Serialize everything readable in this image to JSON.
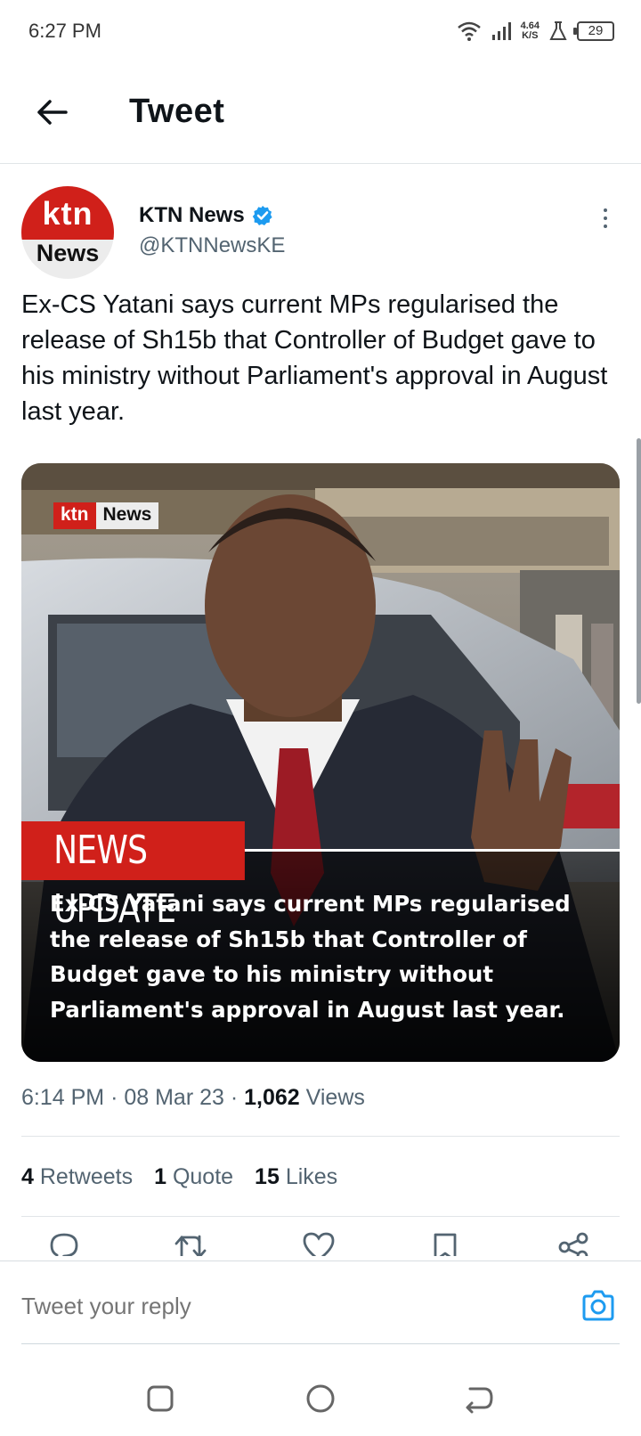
{
  "status_bar": {
    "time": "6:27 PM",
    "net_speed_value": "4.64",
    "net_speed_unit": "K/S",
    "battery": "29"
  },
  "header": {
    "title": "Tweet"
  },
  "tweet": {
    "author_name": "KTN News",
    "author_handle": "@KTNNewsKE",
    "avatar_top": "ktn",
    "avatar_bottom": "News",
    "text": "Ex-CS Yatani says current MPs regularised the release of Sh15b that Controller of Budget gave to his ministry without Parliament's approval in August last year.",
    "media": {
      "logo_ktn": "ktn",
      "logo_news": "News",
      "banner": "NEWS UPDATE",
      "caption_lines": [
        "Ex-CS Yatani says current MPs regularised",
        "the release of Sh15b that Controller of",
        "Budget gave to his ministry without",
        "Parliament's approval in August last year."
      ]
    },
    "time": "6:14 PM",
    "date": "08 Mar 23",
    "views_count": "1,062",
    "views_label": "Views",
    "separator": "·",
    "stats": {
      "retweets_count": "4",
      "retweets_label": "Retweets",
      "quotes_count": "1",
      "quotes_label": "Quote",
      "likes_count": "15",
      "likes_label": "Likes"
    }
  },
  "reply": {
    "placeholder": "Tweet your reply"
  },
  "colors": {
    "accent": "#1d9bf0",
    "ktn_red": "#d0201a",
    "text": "#0f1419",
    "muted": "#536471"
  }
}
